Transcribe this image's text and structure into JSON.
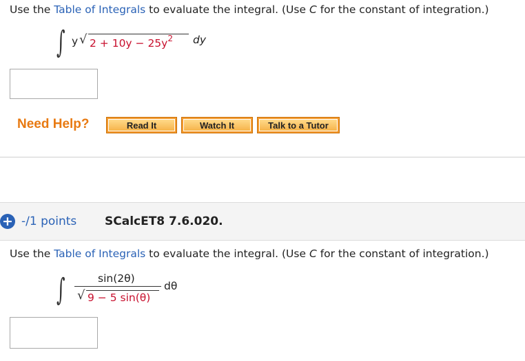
{
  "q1": {
    "prompt_pre": "Use the ",
    "prompt_link": "Table of Integrals",
    "prompt_mid": " to evaluate the integral. (Use ",
    "prompt_c": "C",
    "prompt_post": " for the constant of integration.)",
    "math": {
      "integral": "∫",
      "y": "y",
      "sqrt": "√",
      "radicand": "2 + 10y − 25y",
      "exp": "2",
      "dy": "dy"
    },
    "answer_value": ""
  },
  "help": {
    "label": "Need Help?",
    "read_it": "Read It",
    "watch_it": "Watch It",
    "talk_tutor": "Talk to a Tutor"
  },
  "q2": {
    "expand_icon": "+",
    "points": "-/1 points",
    "id": "SCalcET8 7.6.020.",
    "prompt_pre": "Use the ",
    "prompt_link": "Table of Integrals",
    "prompt_mid": " to evaluate the integral. (Use ",
    "prompt_c": "C",
    "prompt_post": " for the constant of integration.)",
    "math": {
      "integral": "∫",
      "numerator": "sin(2θ)",
      "sqrt": "√",
      "denominator": "9 − 5 sin(θ)",
      "dtheta": "dθ"
    },
    "answer_value": ""
  },
  "colors": {
    "link": "#2a62b6",
    "math_red": "#c8102e",
    "need_help": "#e87a12",
    "button": "#f49a2d"
  }
}
